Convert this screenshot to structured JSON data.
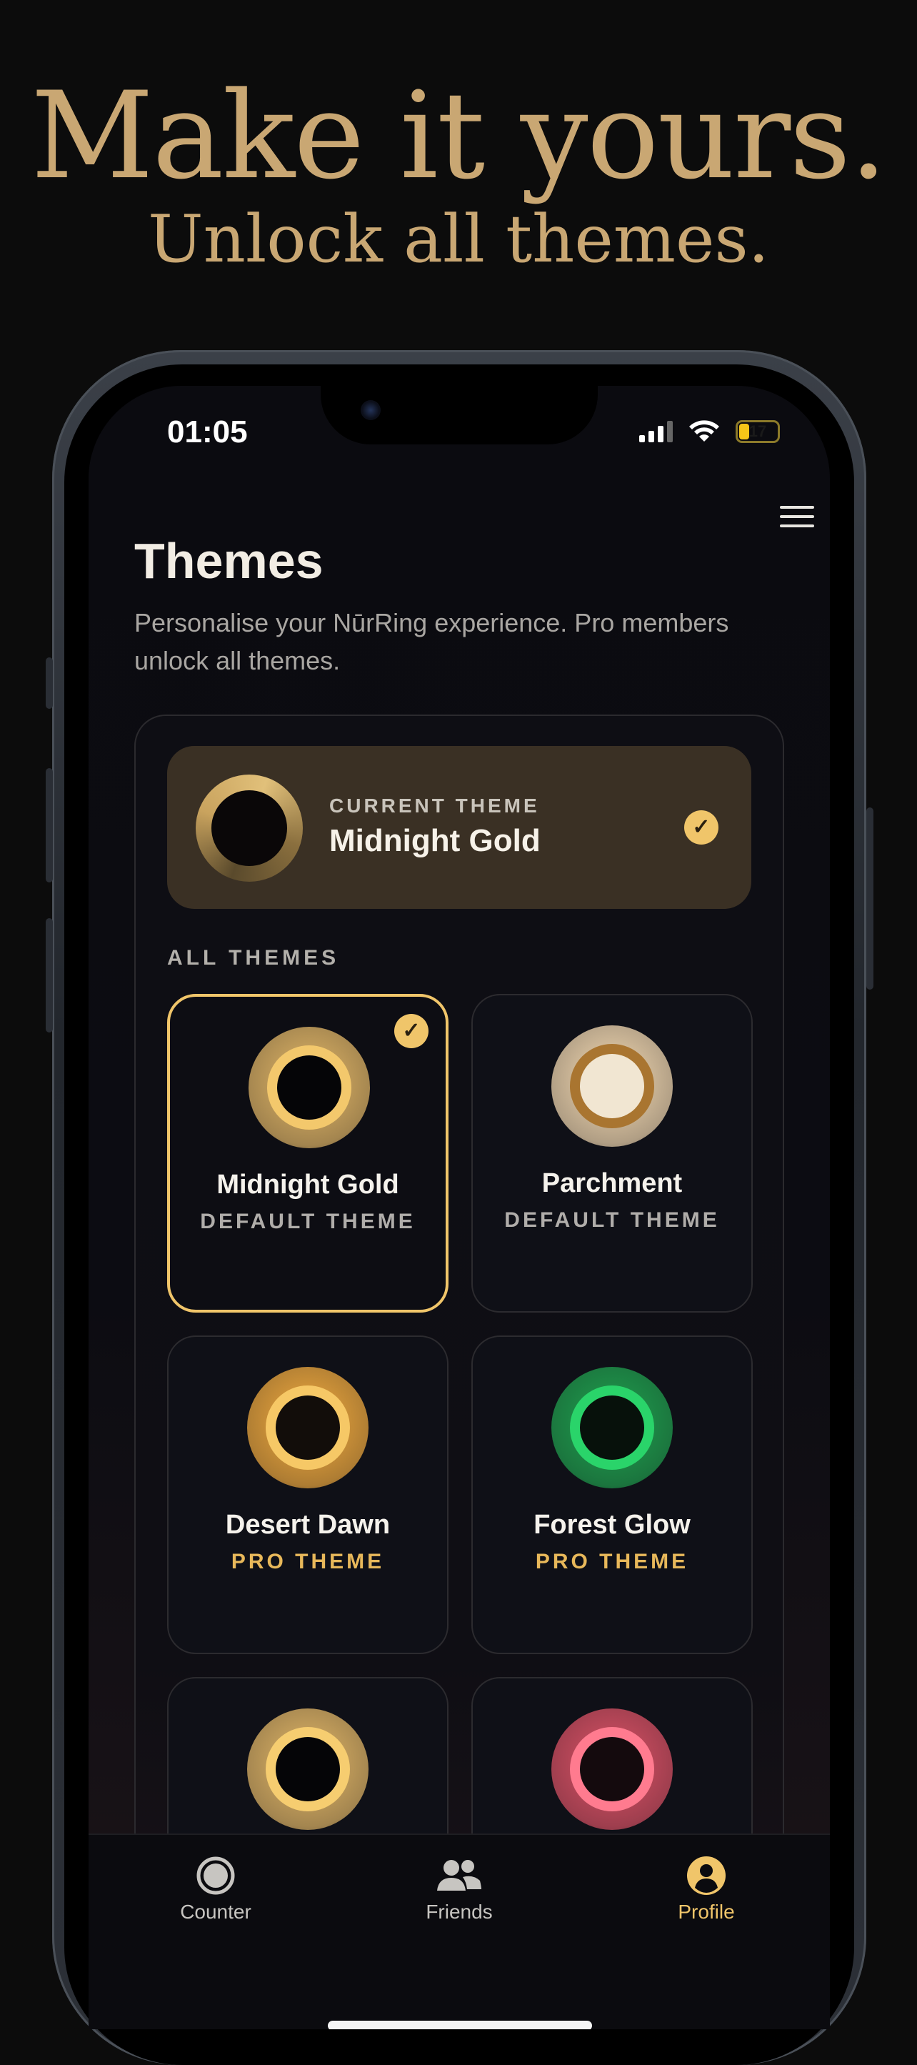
{
  "hero": {
    "title": "Make it yours.",
    "subtitle": "Unlock all themes."
  },
  "status_bar": {
    "time": "01:05",
    "battery": "17"
  },
  "page": {
    "title": "Themes",
    "description": "Personalise your NūrRing experience. Pro members unlock all themes."
  },
  "current_theme": {
    "label": "CURRENT THEME",
    "name": "Midnight Gold"
  },
  "all_themes_label": "ALL THEMES",
  "themes": [
    {
      "name": "Midnight Gold",
      "tag": "DEFAULT THEME",
      "pro": false,
      "selected": true,
      "colors": {
        "outer": "#c9a35e",
        "inner": "#f3c86c",
        "hole": "#050507"
      }
    },
    {
      "name": "Parchment",
      "tag": "DEFAULT THEME",
      "pro": false,
      "selected": false,
      "colors": {
        "outer": "#d9c2a0",
        "inner": "#a97530",
        "hole": "#f1e6d2"
      }
    },
    {
      "name": "Desert Dawn",
      "tag": "PRO THEME",
      "pro": true,
      "selected": false,
      "colors": {
        "outer": "#d6983a",
        "inner": "#f6c866",
        "hole": "#120d0a"
      }
    },
    {
      "name": "Forest Glow",
      "tag": "PRO THEME",
      "pro": true,
      "selected": false,
      "colors": {
        "outer": "#1e8f48",
        "inner": "#2ad46a",
        "hole": "#07110b"
      }
    },
    {
      "name": "",
      "tag": "",
      "pro": true,
      "selected": false,
      "colors": {
        "outer": "#c9a35e",
        "inner": "#f6cd70",
        "hole": "#050507"
      }
    },
    {
      "name": "",
      "tag": "",
      "pro": true,
      "selected": false,
      "colors": {
        "outer": "#c24a5c",
        "inner": "#ff7b8f",
        "hole": "#140a0d"
      }
    }
  ],
  "tabs": [
    {
      "label": "Counter",
      "icon": "counter-icon",
      "active": false
    },
    {
      "label": "Friends",
      "icon": "friends-icon",
      "active": false
    },
    {
      "label": "Profile",
      "icon": "profile-icon",
      "active": true
    }
  ],
  "colors": {
    "accent": "#f0c56a",
    "hero_text": "#c9a773",
    "pro_tag": "#e8b85a"
  }
}
